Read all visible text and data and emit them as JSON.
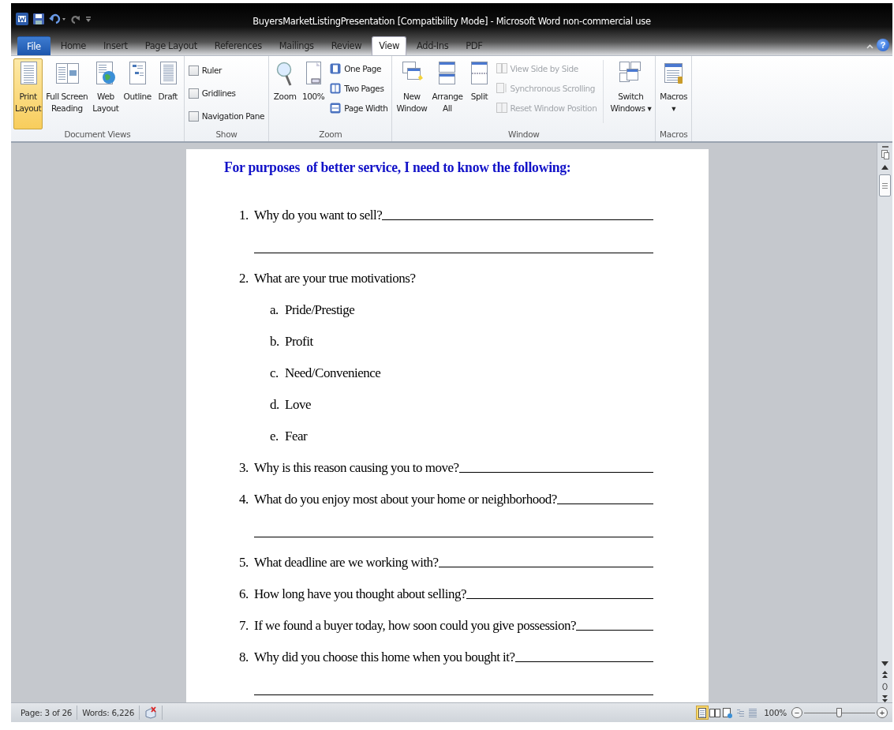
{
  "window": {
    "title": "BuyersMarketListingPresentation [Compatibility Mode]  -  Microsoft Word non-commercial use",
    "help": "?"
  },
  "tabs": [
    {
      "label": "File",
      "kind": "file",
      "selected": false
    },
    {
      "label": "Home",
      "kind": "tab",
      "selected": false
    },
    {
      "label": "Insert",
      "kind": "tab",
      "selected": false
    },
    {
      "label": "Page Layout",
      "kind": "tab",
      "selected": false
    },
    {
      "label": "References",
      "kind": "tab",
      "selected": false
    },
    {
      "label": "Mailings",
      "kind": "tab",
      "selected": false
    },
    {
      "label": "Review",
      "kind": "tab",
      "selected": false
    },
    {
      "label": "View",
      "kind": "tab",
      "selected": true
    },
    {
      "label": "Add-Ins",
      "kind": "tab",
      "selected": false
    },
    {
      "label": "PDF",
      "kind": "tab",
      "selected": false
    }
  ],
  "ribbon": [
    {
      "label": "Document Views",
      "items": [
        {
          "kind": "large",
          "lines": [
            "Print",
            "Layout"
          ],
          "selected": true
        },
        {
          "kind": "large",
          "lines": [
            "Full Screen",
            "Reading"
          ],
          "selected": false
        },
        {
          "kind": "large",
          "lines": [
            "Web",
            "Layout"
          ],
          "selected": false
        },
        {
          "kind": "large",
          "lines": [
            "Outline"
          ],
          "selected": false
        },
        {
          "kind": "large",
          "lines": [
            "Draft"
          ],
          "selected": false
        }
      ]
    },
    {
      "label": "Show",
      "items": [
        {
          "kind": "check",
          "label": "Ruler",
          "checked": false
        },
        {
          "kind": "check",
          "label": "Gridlines",
          "checked": false
        },
        {
          "kind": "check",
          "label": "Navigation Pane",
          "checked": false
        }
      ]
    },
    {
      "label": "Zoom",
      "items": [
        {
          "kind": "large",
          "lines": [
            "Zoom"
          ]
        },
        {
          "kind": "large",
          "lines": [
            "100%"
          ]
        },
        {
          "kind": "small",
          "label": "One Page",
          "disabled": false
        },
        {
          "kind": "small",
          "label": "Two Pages",
          "disabled": false
        },
        {
          "kind": "small",
          "label": "Page Width",
          "disabled": false
        }
      ]
    },
    {
      "label": "Window",
      "items": [
        {
          "kind": "large",
          "lines": [
            "New",
            "Window"
          ]
        },
        {
          "kind": "large",
          "lines": [
            "Arrange",
            "All"
          ]
        },
        {
          "kind": "large",
          "lines": [
            "Split"
          ]
        },
        {
          "kind": "small",
          "label": "View Side by Side",
          "disabled": true
        },
        {
          "kind": "small",
          "label": "Synchronous Scrolling",
          "disabled": true
        },
        {
          "kind": "small",
          "label": "Reset Window Position",
          "disabled": true
        },
        {
          "kind": "large",
          "lines": [
            "Switch",
            "Windows ▾"
          ]
        }
      ]
    },
    {
      "label": "Macros",
      "items": [
        {
          "kind": "large",
          "lines": [
            "Macros",
            "▾"
          ]
        }
      ]
    }
  ],
  "document": {
    "heading": "For purposes  of better service, I need to know the following:",
    "questions": [
      {
        "number": "1.",
        "text": "Why do you want to sell?",
        "blank": true,
        "extra_line": true
      },
      {
        "number": "2.",
        "text": "What are your true motivations?",
        "blank": false,
        "extra_line": false,
        "children": [
          {
            "number": "a.",
            "text": "Pride/Prestige"
          },
          {
            "number": "b.",
            "text": "Profit"
          },
          {
            "number": "c.",
            "text": "Need/Convenience"
          },
          {
            "number": "d.",
            "text": "Love"
          },
          {
            "number": "e.",
            "text": "Fear"
          }
        ]
      },
      {
        "number": "3.",
        "text": "Why is this reason causing you to move?",
        "blank": true,
        "extra_line": false
      },
      {
        "number": "4.",
        "text": "What do you enjoy most about your home or neighborhood?",
        "blank": true,
        "extra_line": true
      },
      {
        "number": "5.",
        "text": "What deadline are we working with?",
        "blank": true,
        "extra_line": false
      },
      {
        "number": "6.",
        "text": "How long have you thought about selling?",
        "blank": true,
        "extra_line": false
      },
      {
        "number": "7.",
        "text": "If we found a buyer today, how soon could you give possession?",
        "blank": true,
        "extra_line": false
      },
      {
        "number": "8.",
        "text": "Why did you choose this home when you bought it?",
        "blank": true,
        "extra_line": true
      }
    ]
  },
  "status_bar": {
    "page": "Page: 3 of 26",
    "words": "Words: 6,226",
    "views": [
      {
        "selected": true
      },
      {
        "selected": false
      },
      {
        "selected": false
      },
      {
        "selected": false
      },
      {
        "selected": false
      }
    ],
    "zoom": "100%",
    "zoom_out": "−",
    "zoom_in": "+",
    "zoom_slider": {
      "level": 0.5
    }
  }
}
